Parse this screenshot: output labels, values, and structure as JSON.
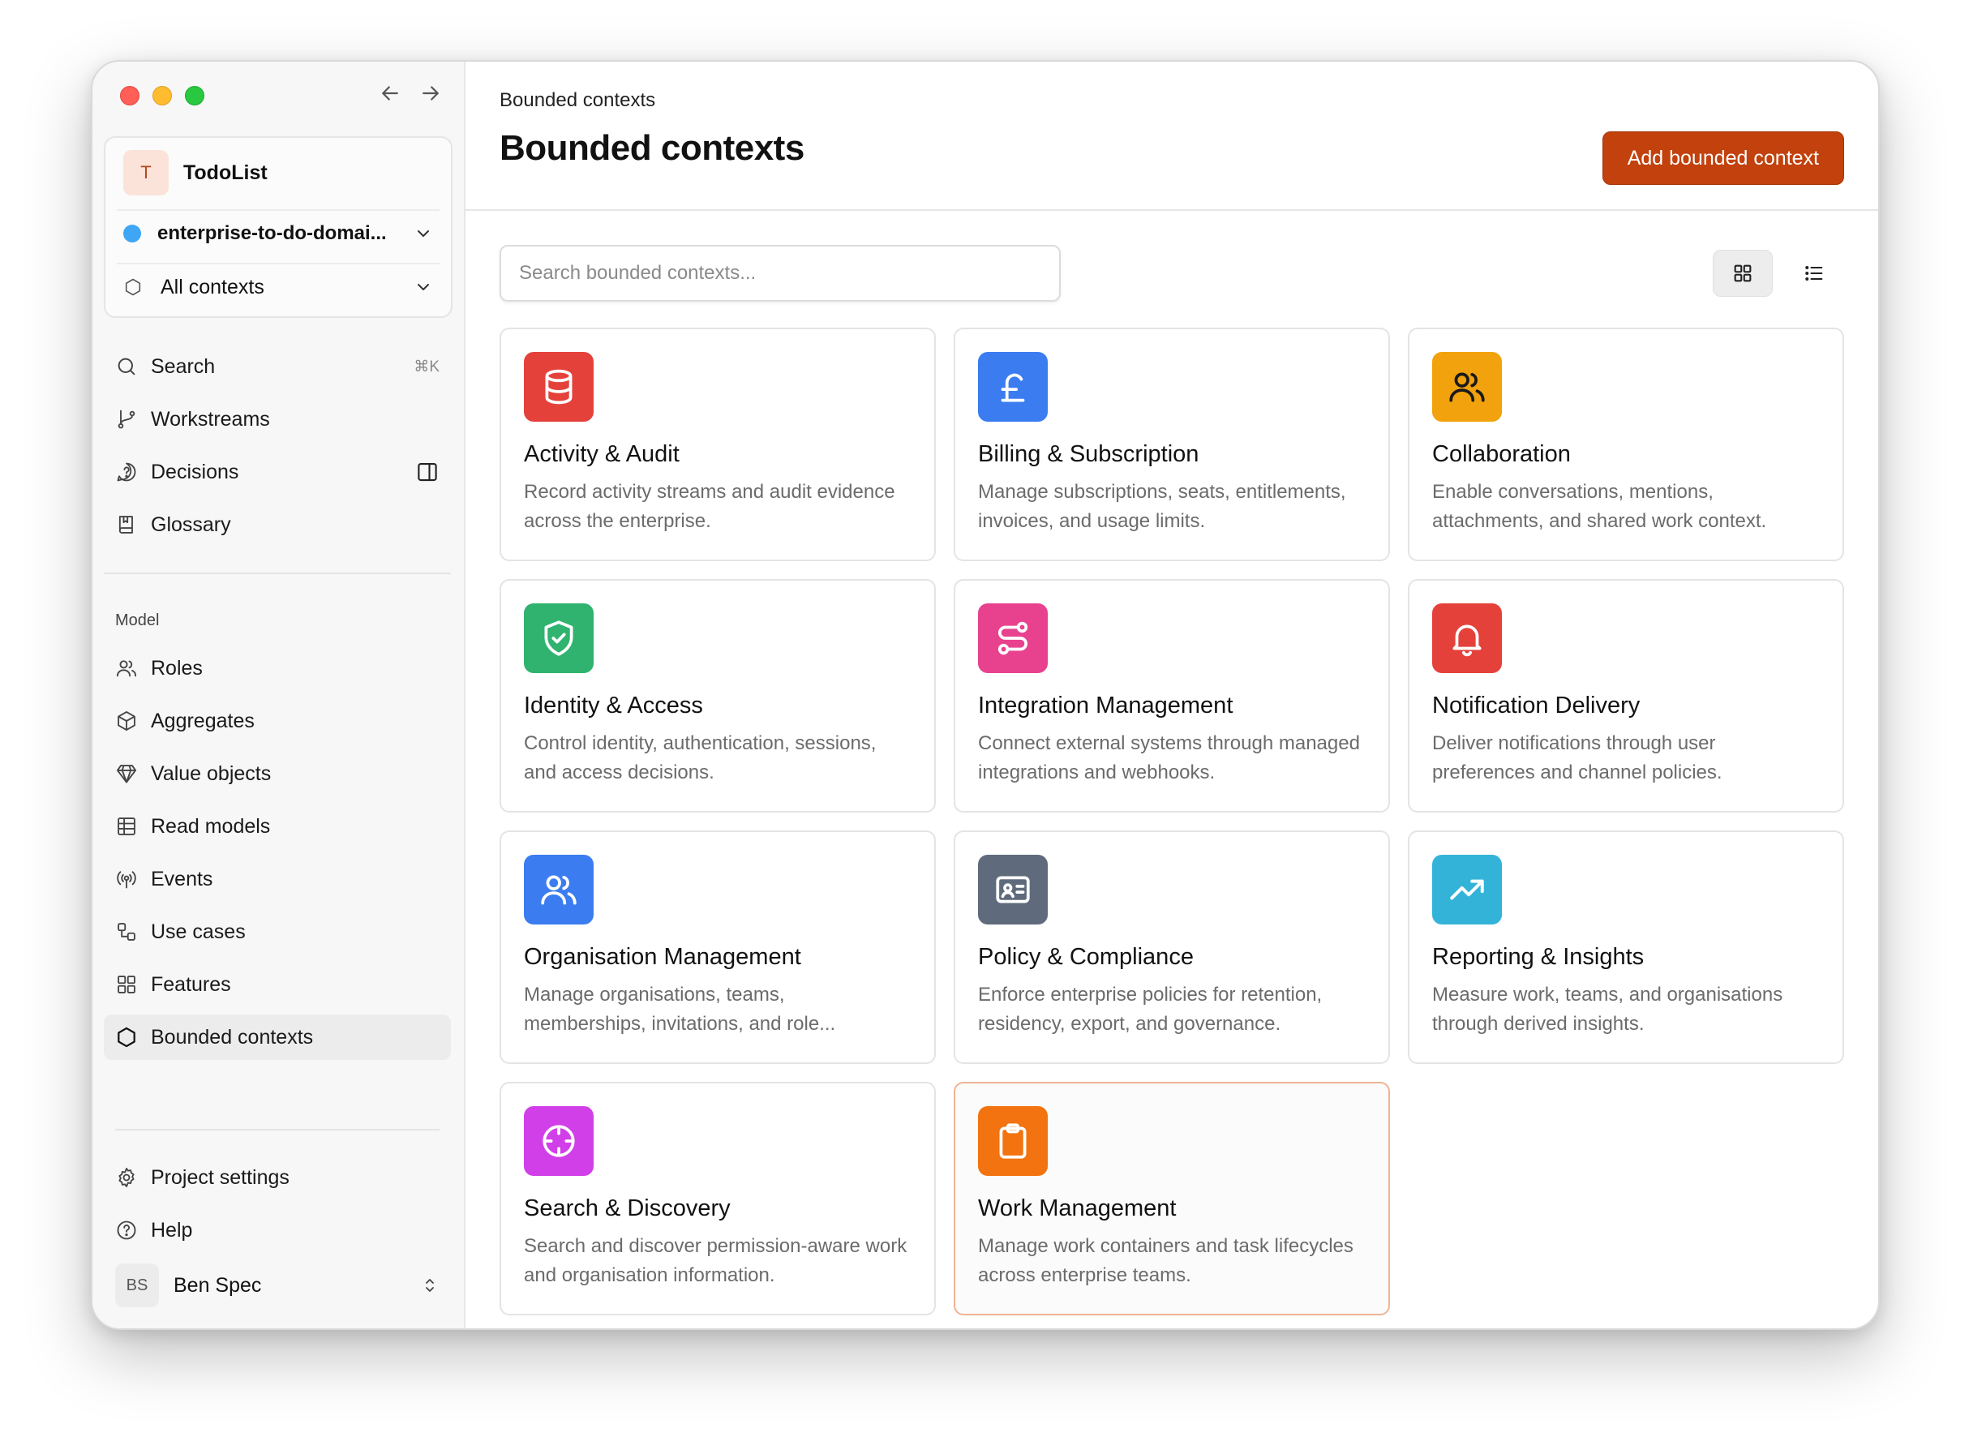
{
  "workspace": {
    "avatar_letter": "T",
    "project_name": "TodoList",
    "domain": "enterprise-to-do-domai...",
    "context_filter": "All contexts"
  },
  "nav_main": [
    {
      "label": "Search",
      "shortcut": "⌘K",
      "icon": "search-icon"
    },
    {
      "label": "Workstreams",
      "icon": "git-branch-icon"
    },
    {
      "label": "Decisions",
      "icon": "question-bubble-icon"
    },
    {
      "label": "Glossary",
      "icon": "book-icon"
    }
  ],
  "model_section_label": "Model",
  "nav_model": [
    {
      "label": "Roles",
      "icon": "users-icon"
    },
    {
      "label": "Aggregates",
      "icon": "cube-icon"
    },
    {
      "label": "Value objects",
      "icon": "gem-icon"
    },
    {
      "label": "Read models",
      "icon": "table-icon"
    },
    {
      "label": "Events",
      "icon": "broadcast-icon"
    },
    {
      "label": "Use cases",
      "icon": "workflow-icon"
    },
    {
      "label": "Features",
      "icon": "grid-icon"
    },
    {
      "label": "Bounded contexts",
      "icon": "hexagon-icon"
    }
  ],
  "nav_footer": [
    {
      "label": "Project settings",
      "icon": "gear-icon"
    },
    {
      "label": "Help",
      "icon": "help-icon"
    }
  ],
  "user": {
    "initials": "BS",
    "name": "Ben Spec"
  },
  "header": {
    "breadcrumb": "Bounded contexts",
    "title": "Bounded contexts",
    "add_button": "Add bounded context"
  },
  "search": {
    "placeholder": "Search bounded contexts..."
  },
  "cards": [
    {
      "title": "Activity & Audit",
      "description": "Record activity streams and audit evidence across the enterprise.",
      "icon": "database-icon",
      "color": "#e5413b"
    },
    {
      "title": "Billing & Subscription",
      "description": "Manage subscriptions, seats, entitlements, invoices, and usage limits.",
      "icon": "pound-icon",
      "color": "#3b7cf0"
    },
    {
      "title": "Collaboration",
      "description": "Enable conversations, mentions, attachments, and shared work context.",
      "icon": "users-icon",
      "color": "#f2a20d"
    },
    {
      "title": "Identity & Access",
      "description": "Control identity, authentication, sessions, and access decisions.",
      "icon": "shield-check-icon",
      "color": "#2fb36f"
    },
    {
      "title": "Integration Management",
      "description": "Connect external systems through managed integrations and webhooks.",
      "icon": "route-icon",
      "color": "#e8428f"
    },
    {
      "title": "Notification Delivery",
      "description": "Deliver notifications through user preferences and channel policies.",
      "icon": "bell-icon",
      "color": "#e5413b"
    },
    {
      "title": "Organisation Management",
      "description": "Manage organisations, teams, memberships, invitations, and role...",
      "icon": "users-icon",
      "color": "#3b7cf0"
    },
    {
      "title": "Policy & Compliance",
      "description": "Enforce enterprise policies for retention, residency, export, and governance.",
      "icon": "id-card-icon",
      "color": "#5f6b7c"
    },
    {
      "title": "Reporting & Insights",
      "description": "Measure work, teams, and organisations through derived insights.",
      "icon": "trending-up-icon",
      "color": "#34b3d9"
    },
    {
      "title": "Search & Discovery",
      "description": "Search and discover permission-aware work and organisation information.",
      "icon": "crosshair-icon",
      "color": "#d13fe8"
    },
    {
      "title": "Work Management",
      "description": "Manage work containers and task lifecycles across enterprise teams.",
      "icon": "clipboard-icon",
      "color": "#f2730f"
    }
  ]
}
